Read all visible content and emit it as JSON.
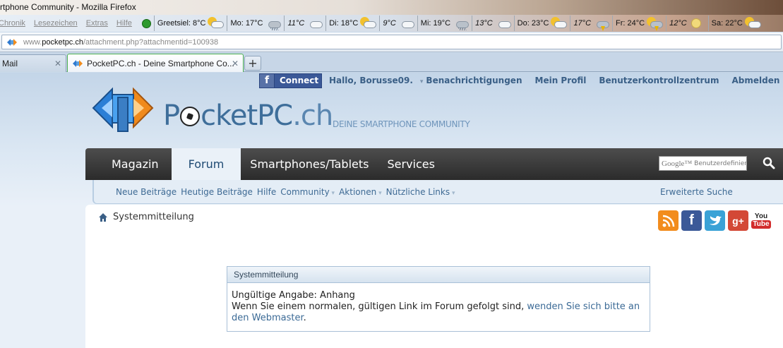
{
  "window": {
    "title": "rtphone Community - Mozilla Firefox"
  },
  "menu": {
    "items": [
      "Chronik",
      "Lesezeichen",
      "Extras",
      "Hilfe"
    ]
  },
  "weather": [
    {
      "label": "Greetsiel: 8°C",
      "icon": "sun-cloud-icon",
      "italic": false
    },
    {
      "label": "Mo: 17°C",
      "icon": "cloud-rain-icon",
      "italic": false
    },
    {
      "label": "11°C",
      "icon": "cloud-icon",
      "italic": true
    },
    {
      "label": "Di: 18°C",
      "icon": "sun-cloud-icon",
      "italic": false
    },
    {
      "label": "9°C",
      "icon": "cloud-icon",
      "italic": true
    },
    {
      "label": "Mi: 19°C",
      "icon": "cloud-rain-icon",
      "italic": false
    },
    {
      "label": "13°C",
      "icon": "cloud-icon",
      "italic": true
    },
    {
      "label": "Do: 23°C",
      "icon": "sun-cloud-icon",
      "italic": false
    },
    {
      "label": "17°C",
      "icon": "cloud-storm-icon",
      "italic": true
    },
    {
      "label": "Fr: 24°C",
      "icon": "sun-storm-icon",
      "italic": false
    },
    {
      "label": "12°C",
      "icon": "moon-icon",
      "italic": true
    },
    {
      "label": "Sa: 22°C",
      "icon": "sun-cloud-icon",
      "italic": false
    }
  ],
  "address": {
    "prefix": "www.",
    "domain": "pocketpc.ch",
    "path": "/attachment.php?attachmentid=100938"
  },
  "tabs": [
    {
      "label": "Mail",
      "active": false
    },
    {
      "label": "PocketPC.ch - Deine Smartphone Co...",
      "active": true
    }
  ],
  "newtab_label": "+",
  "topnav": {
    "connect_label": "Connect",
    "greeting": "Hallo, Borusse09.",
    "notifications": "Benachrichtigungen",
    "profile": "Mein Profil",
    "usercp": "Benutzerkontrollzentrum",
    "logout": "Abmelden"
  },
  "brand": {
    "name_part1": "P",
    "name_part2": "cketPC",
    "name_part3": ".ch",
    "tagline": "DEINE SMARTPHONE COMMUNITY"
  },
  "mainnav": {
    "items": [
      "Magazin",
      "Forum",
      "Smartphones/Tablets",
      "Services"
    ],
    "search_google": "Google™",
    "search_placeholder": "Benutzerdefinierte Suche"
  },
  "subnav": {
    "items": [
      "Neue Beiträge",
      "Heutige Beiträge",
      "Hilfe",
      "Community",
      "Aktionen",
      "Nützliche Links"
    ],
    "advanced_search": "Erweiterte Suche"
  },
  "breadcrumb": "Systemmitteilung",
  "social": {
    "youtube_you": "You",
    "youtube_tube": "Tube"
  },
  "message": {
    "title": "Systemmitteilung",
    "line1": "Ungültige Angabe: Anhang",
    "line2_text": "Wenn Sie einem normalen, gültigen Link im Forum gefolgt sind,",
    "line2_link": "wenden Sie sich bitte an den Webmaster",
    "line2_end": "."
  },
  "colors": {
    "accent": "#3b6a96",
    "nav_dark": "#2b2b2b",
    "facebook": "#3b5998",
    "rss": "#f28c1d"
  }
}
